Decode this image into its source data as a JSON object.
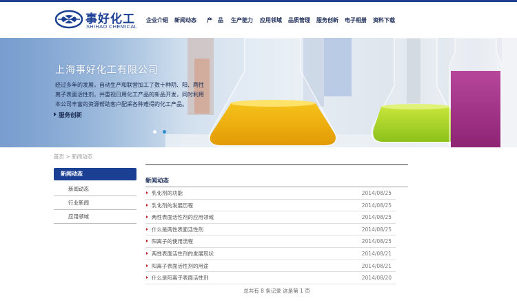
{
  "header": {
    "logo_cn": "事好化工",
    "logo_en": "SHIHAO CHEMICAL",
    "nav": [
      "企业介绍",
      "新闻动态",
      "产　品",
      "生产能力",
      "应用领域",
      "品质管理",
      "服务创新",
      "电子相册",
      "资料下载"
    ]
  },
  "banner": {
    "title": "上海事好化工有限公司",
    "description": "经过多年的发展，自动生产和联营加工了数十种阴、阳、两性离子表面活性剂，并重视日用化工产品的新品开发，同时利用本公司丰富的资源帮助客户配采各种难得的化工产品。",
    "link": "服务创新",
    "slides": 2,
    "active_slide": 2
  },
  "breadcrumb": {
    "home": "首页",
    "separator": ">",
    "current": "新闻动态"
  },
  "sidebar": {
    "heading": "新闻动态",
    "items": [
      "新闻动态",
      "行业新闻",
      "应用领域"
    ]
  },
  "main": {
    "title": "新闻动态",
    "news": [
      {
        "title": "乳化剂的功能",
        "date": "2014/08/25"
      },
      {
        "title": "乳化剂的发展历程",
        "date": "2014/08/25"
      },
      {
        "title": "两性表面活性剂的应用领域",
        "date": "2014/08/25"
      },
      {
        "title": "什么是两性表面活性剂",
        "date": "2014/08/25"
      },
      {
        "title": "阳离子的使用流程",
        "date": "2014/08/25"
      },
      {
        "title": "两性表面活性剂的发展现状",
        "date": "2014/08/21"
      },
      {
        "title": "阳离子表面活性剂的用途",
        "date": "2014/08/21"
      },
      {
        "title": "什么是阳离子表面活性剂",
        "date": "2014/08/20"
      }
    ],
    "pager": "总共有 8 条记录 这是第 1 页"
  },
  "colors": {
    "brand": "#1b3f93",
    "bullet": "#c0282d",
    "active_dot": "#2a8fd0"
  }
}
